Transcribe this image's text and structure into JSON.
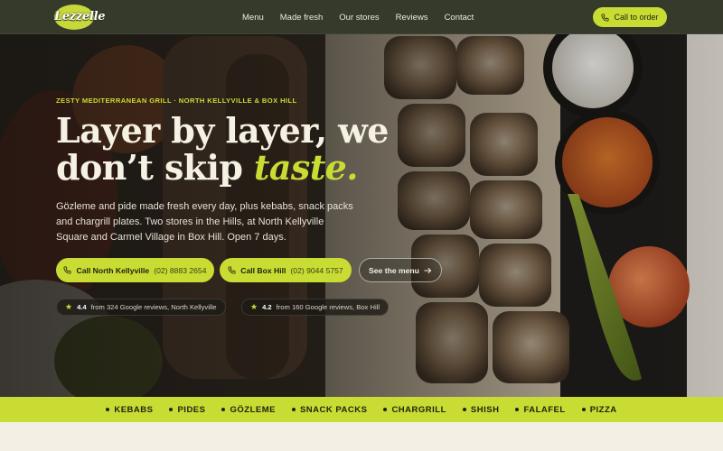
{
  "brand": {
    "logo_text": "Lezzelle"
  },
  "nav": {
    "links": [
      "Menu",
      "Made fresh",
      "Our stores",
      "Reviews",
      "Contact"
    ],
    "cta_label": "Call to order"
  },
  "hero": {
    "eyebrow": "ZESTY MEDITERRANEAN GRILL · NORTH KELLYVILLE & BOX HILL",
    "headline_line1": "Layer by layer, we",
    "headline_line2": "don’t skip ",
    "headline_accent": "taste.",
    "lede": "Gözleme and pide made fresh every day, plus kebabs, snack packs and chargrill plates. Two stores in the Hills, at North Kellyville Square and Carmel Village in Box Hill. Open 7 days.",
    "buttons": {
      "call_nk_label": "Call North Kellyville",
      "call_nk_number": "(02) 8883 2654",
      "call_bh_label": "Call Box Hill",
      "call_bh_number": "(02) 9044 5757",
      "menu_label": "See the menu"
    },
    "ratings": [
      {
        "score": "4.4",
        "text": "from 324 Google reviews, North Kellyville"
      },
      {
        "score": "4.2",
        "text": "from 160 Google reviews, Box Hill"
      }
    ]
  },
  "categories": [
    "KEBABS",
    "PIDES",
    "GÖZLEME",
    "SNACK PACKS",
    "CHARGRILL",
    "SHISH",
    "FALAFEL",
    "PIZZA"
  ],
  "colors": {
    "accent": "#c9dc33",
    "nav_bg": "#353a2b",
    "page_bg": "#f3efe4"
  },
  "icons": {
    "phone": "phone-icon",
    "star": "star-icon",
    "arrow": "arrow-right-icon"
  }
}
